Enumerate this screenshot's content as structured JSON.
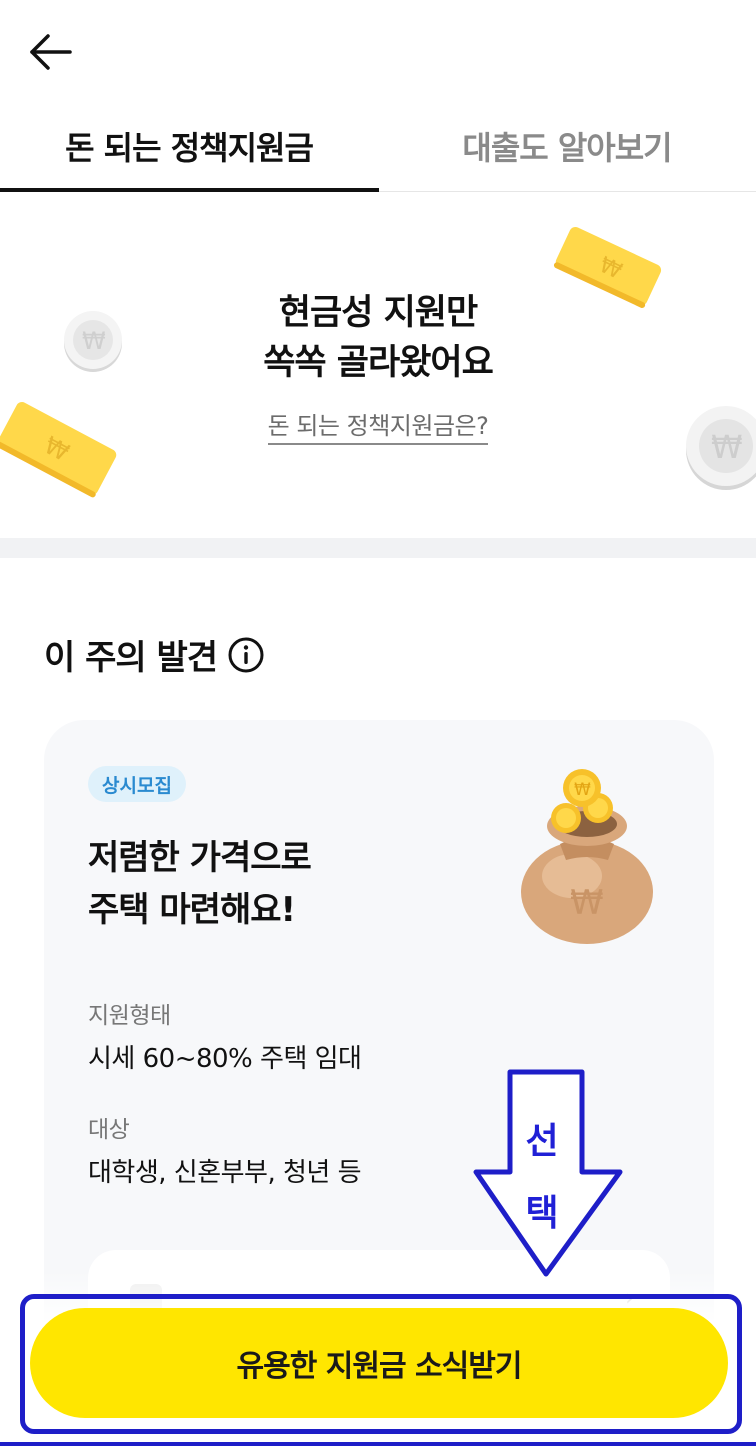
{
  "tabs": {
    "active_label": "돈 되는 정책지원금",
    "inactive_label": "대출도 알아보기"
  },
  "hero": {
    "title_line1": "현금성 지원만",
    "title_line2": "쏙쏙 골라왔어요",
    "link_text": "돈 되는 정책지원금은?"
  },
  "section": {
    "title": "이 주의 발견"
  },
  "card": {
    "badge": "상시모집",
    "title_line1": "저렴한 가격으로",
    "title_line2": "주택 마련해요!",
    "support_type_label": "지원형태",
    "support_type_value": "시세 60~80% 주택 임대",
    "target_label": "대상",
    "target_value": "대학생, 신혼부부, 청년 등"
  },
  "cta": {
    "label": "유용한 지원금 소식받기"
  },
  "annotation": {
    "char1": "선",
    "char2": "택"
  },
  "colors": {
    "accent_yellow": "#ffe600",
    "badge_bg": "#dff1fb",
    "badge_text": "#2a8ad0",
    "annotation_blue": "#1e1ec8"
  }
}
